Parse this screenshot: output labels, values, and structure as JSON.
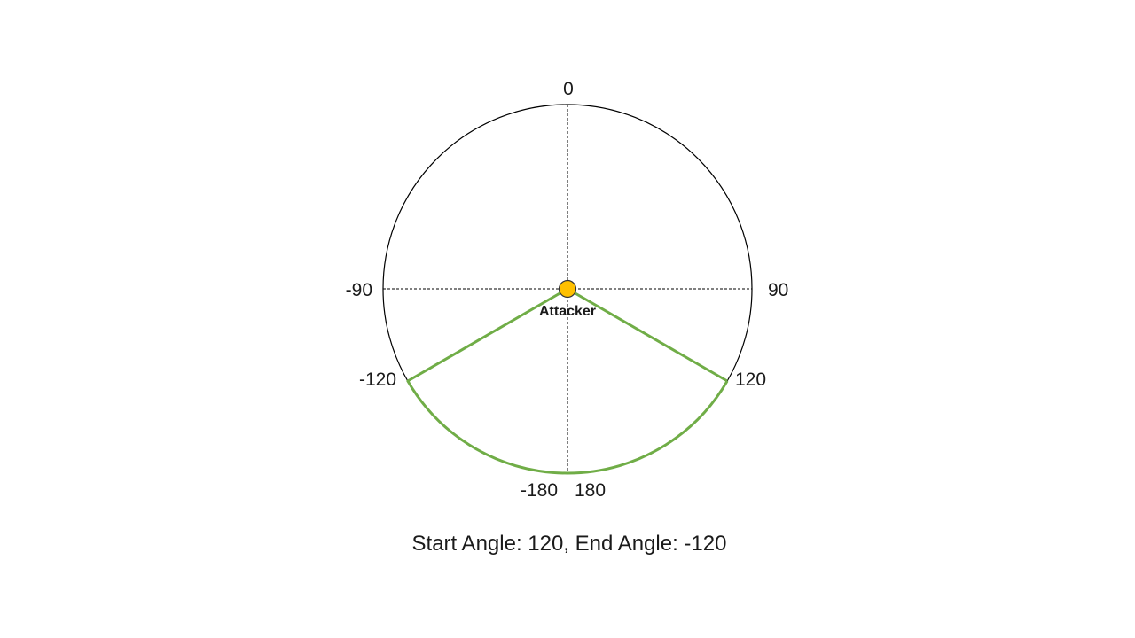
{
  "diagram": {
    "angle_labels": {
      "top": "0",
      "right": "90",
      "left": "-90",
      "lower_right": "120",
      "lower_left": "-120",
      "bottom_right": "180",
      "bottom_left": "-180"
    },
    "attacker_label": "Attacker",
    "caption": "Start Angle: 120, End Angle: -120",
    "sector": {
      "start_angle": 120,
      "end_angle": -120
    },
    "colors": {
      "circle": "#000000",
      "axes": "#000000",
      "sector": "#70ad47",
      "attacker_fill": "#ffc000",
      "attacker_stroke": "#333333"
    }
  }
}
